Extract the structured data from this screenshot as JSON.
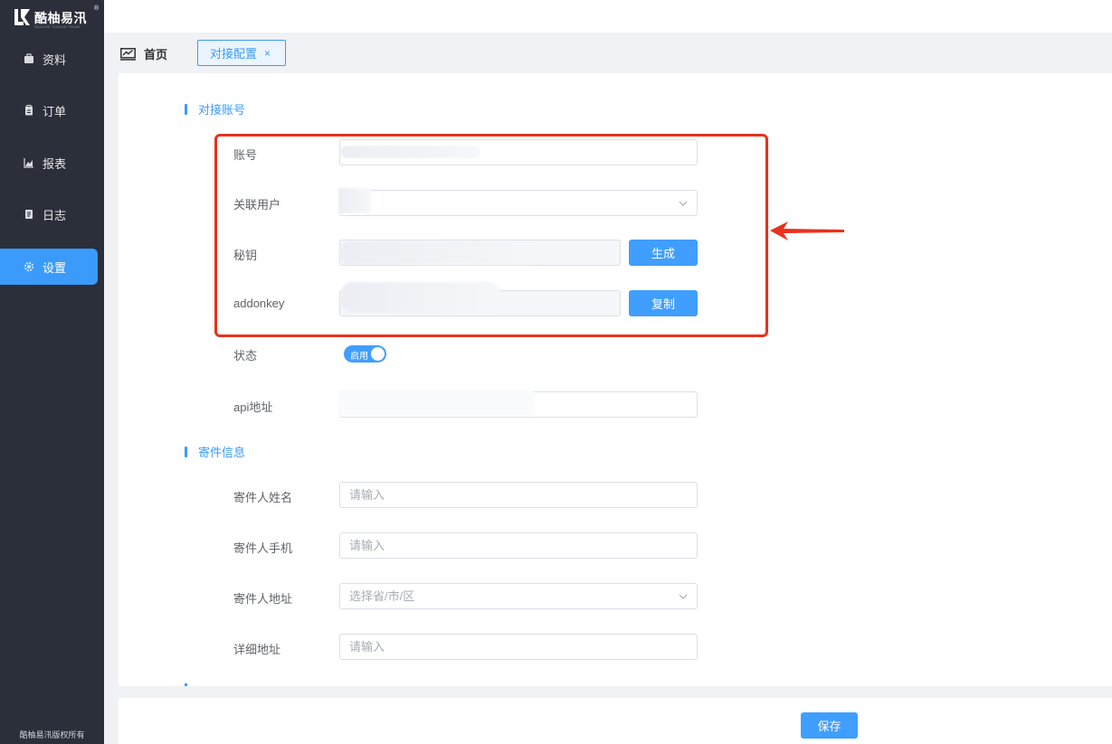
{
  "sidebar": {
    "logo_text": "酷柚易汛",
    "logo_sub": "SAUCHE YOUCAI YIXUN",
    "logo_reg": "®",
    "items": [
      {
        "label": "资料",
        "icon": "briefcase-icon"
      },
      {
        "label": "订单",
        "icon": "clipboard-icon"
      },
      {
        "label": "报表",
        "icon": "chart-icon"
      },
      {
        "label": "日志",
        "icon": "document-icon"
      },
      {
        "label": "设置",
        "icon": "gear-icon",
        "active": true
      }
    ],
    "copyright": "酷柚易汛版权所有"
  },
  "tabs": {
    "home": "首页",
    "current": "对接配置",
    "close": "×"
  },
  "account_section": {
    "title": "对接账号",
    "account_label": "账号",
    "linked_user_label": "关联用户",
    "secret_label": "秘钥",
    "generate_button": "生成",
    "addonkey_label": "addonkey",
    "copy_button": "复制",
    "status_label": "状态",
    "status_switch": "启用",
    "api_label": "api地址"
  },
  "sender_section": {
    "title": "寄件信息",
    "name_label": "寄件人姓名",
    "name_placeholder": "请输入",
    "phone_label": "寄件人手机",
    "phone_placeholder": "请输入",
    "address_label": "寄件人地址",
    "address_placeholder": "选择省/市/区",
    "detail_label": "详细地址",
    "detail_placeholder": "请输入"
  },
  "footer": {
    "save_button": "保存"
  },
  "colors": {
    "primary": "#409eff",
    "sidebar_bg": "#2b2f3a",
    "highlight": "#e8321c"
  }
}
